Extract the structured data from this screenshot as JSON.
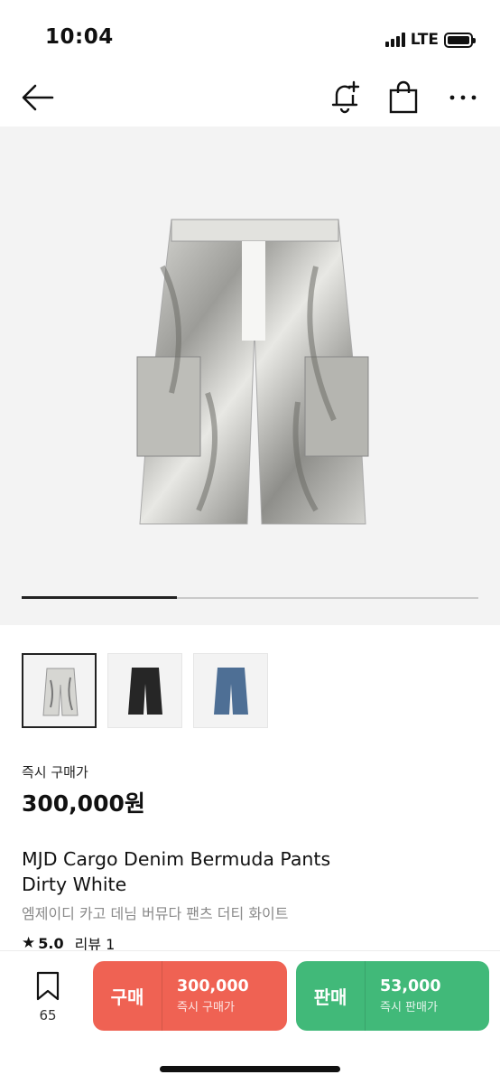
{
  "status": {
    "time": "10:04",
    "network": "LTE"
  },
  "nav": {
    "icons": [
      "back-arrow-icon",
      "alarm-add-icon",
      "shopping-bag-icon",
      "more-icon"
    ]
  },
  "product": {
    "image_progress": 0.34,
    "thumbnails": [
      {
        "color": "dirty-white",
        "selected": true
      },
      {
        "color": "black",
        "selected": false
      },
      {
        "color": "blue-denim",
        "selected": false
      }
    ],
    "price_label": "즉시 구매가",
    "price": "300,000원",
    "title_en_line1": "MJD Cargo Denim Bermuda Pants",
    "title_en_line2": "Dirty White",
    "title_ko": "엠제이디 카고 데님 버뮤다 팬츠 더티 화이트",
    "rating": "5.0",
    "review_label": "리뷰 1"
  },
  "bottom": {
    "wish_count": "65",
    "buy": {
      "label": "구매",
      "price": "300,000",
      "sub": "즉시 구매가",
      "color": "#ef6253"
    },
    "sell": {
      "label": "판매",
      "price": "53,000",
      "sub": "즉시 판매가",
      "color": "#41b979"
    }
  }
}
